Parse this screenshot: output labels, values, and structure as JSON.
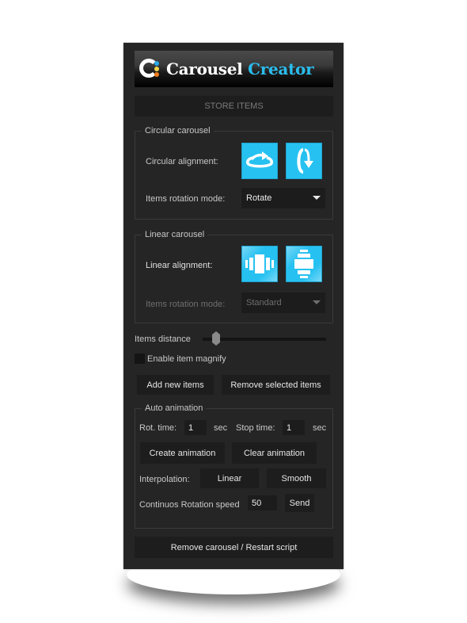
{
  "header": {
    "logo_word1": "Carousel",
    "logo_word2": "Creator",
    "colors": {
      "accent": "#2bbdee",
      "dot_blue": "#2aa8e8",
      "dot_yellow": "#f2d64b",
      "dot_orange": "#f07a1c"
    }
  },
  "store_items_label": "STORE ITEMS",
  "circular": {
    "title": "Circular carousel",
    "alignment_label": "Circular alignment:",
    "alignment_buttons": [
      {
        "icon": "horizontal-rotate-icon"
      },
      {
        "icon": "vertical-rotate-icon"
      }
    ],
    "rotation_mode_label": "Items rotation mode:",
    "rotation_mode_value": "Rotate"
  },
  "linear": {
    "title": "Linear carousel",
    "alignment_label": "Linear alignment:",
    "alignment_buttons": [
      {
        "icon": "horizontal-linear-icon"
      },
      {
        "icon": "vertical-linear-icon"
      }
    ],
    "rotation_mode_label": "Items rotation mode:",
    "rotation_mode_value": "Standard"
  },
  "items_distance": {
    "label": "Items distance",
    "value_fraction": 0.1
  },
  "magnify": {
    "label": "Enable item magnify",
    "checked": false
  },
  "buttons": {
    "add_items": "Add new items",
    "remove_selected": "Remove selected items"
  },
  "auto_animation": {
    "title": "Auto animation",
    "rot_time_label": "Rot. time:",
    "rot_time_value": "1",
    "rot_time_unit": "sec",
    "stop_time_label": "Stop time:",
    "stop_time_value": "1",
    "stop_time_unit": "sec",
    "create_label": "Create animation",
    "clear_label": "Clear animation",
    "interpolation_label": "Interpolation:",
    "linear_label": "Linear",
    "smooth_label": "Smooth",
    "speed_label": "Continuos Rotation speed",
    "speed_value": "50",
    "send_label": "Send"
  },
  "footer_button": "Remove carousel / Restart script"
}
